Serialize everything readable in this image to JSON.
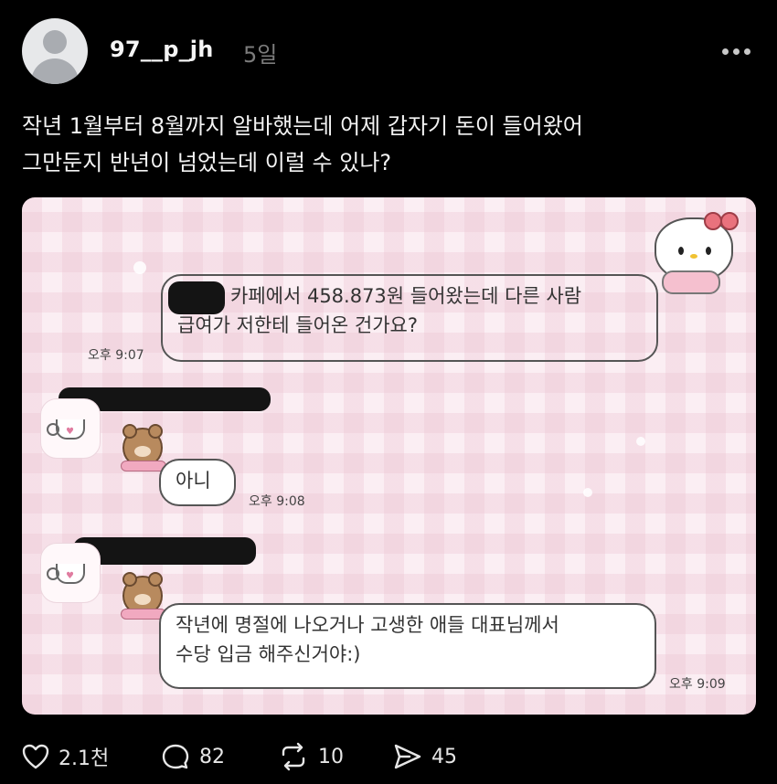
{
  "post": {
    "username": "97__p_jh",
    "time": "5일",
    "text_lines": [
      "작년 1월부터 8월까지 알바했는데 어제 갑자기 돈이 들어왔어",
      "그만둔지 반년이 넘었는데 이럴 수 있나?"
    ]
  },
  "chat": {
    "msg1_lines": [
      "카페에서 458.873원 들어왔는데 다른 사람",
      "급여가 저한테 들어온 건가요?"
    ],
    "msg1_time": "오후 9:07",
    "msg2": "아니",
    "msg2_time": "오후 9:08",
    "msg3_lines": [
      "작년에 명절에 나오거나 고생한 애들 대표님께서",
      "수당 입금 해주신거야:)"
    ],
    "msg3_time": "오후 9:09"
  },
  "actions": {
    "likes": "2.1천",
    "comments": "82",
    "reposts": "10",
    "shares": "45"
  },
  "icons": {
    "like": "heart-icon",
    "comment": "comment-bubble-icon",
    "repost": "repost-icon",
    "share": "send-icon",
    "more": "more-options-icon"
  }
}
